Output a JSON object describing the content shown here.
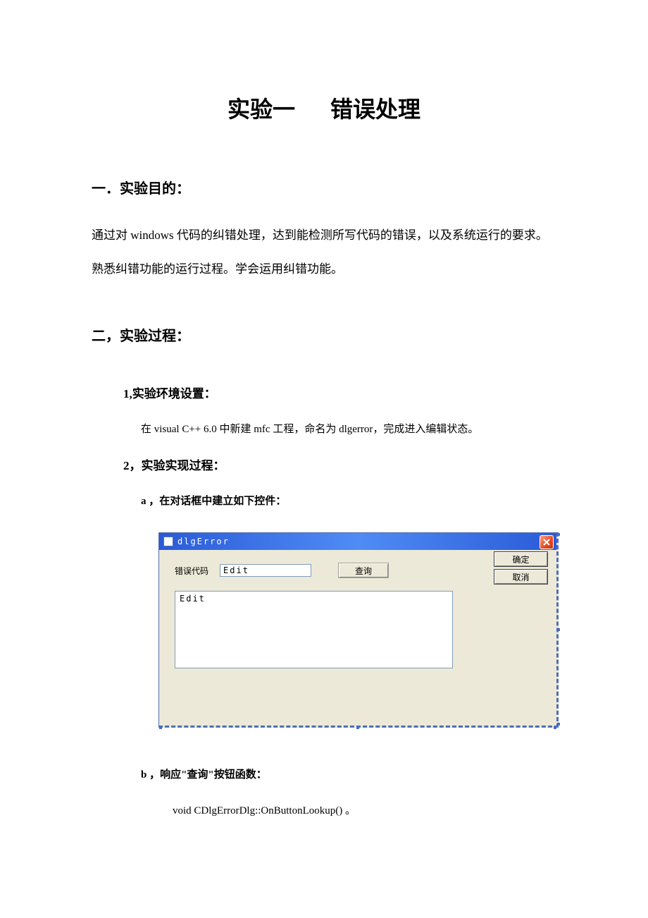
{
  "title": {
    "part1": "实验一",
    "part2": "错误处理"
  },
  "sec1": {
    "heading": "一．实验目的：",
    "body": "通过对 windows 代码的纠错处理，达到能检测所写代码的错误，以及系统运行的要求。熟悉纠错功能的运行过程。学会运用纠错功能。"
  },
  "sec2": {
    "heading": "二，实验过程：",
    "sub1_h": "1,实验环境设置：",
    "sub1_p": "在 visual C++ 6.0 中新建 mfc 工程，命名为 dlgerror，完成进入编辑状态。",
    "sub2_h": "2，实验实现过程：",
    "item_a": "a ，在对话框中建立如下控件：",
    "item_b": "b ，响应\"查询\"按钮函数：",
    "code_b": "void CDlgErrorDlg::OnButtonLookup()  。"
  },
  "dialog": {
    "title": "dlgError",
    "label_code": "错误代码",
    "edit_small": "Edit",
    "btn_query": "查询",
    "btn_ok": "确定",
    "btn_cancel": "取消",
    "edit_large": "Edit"
  }
}
